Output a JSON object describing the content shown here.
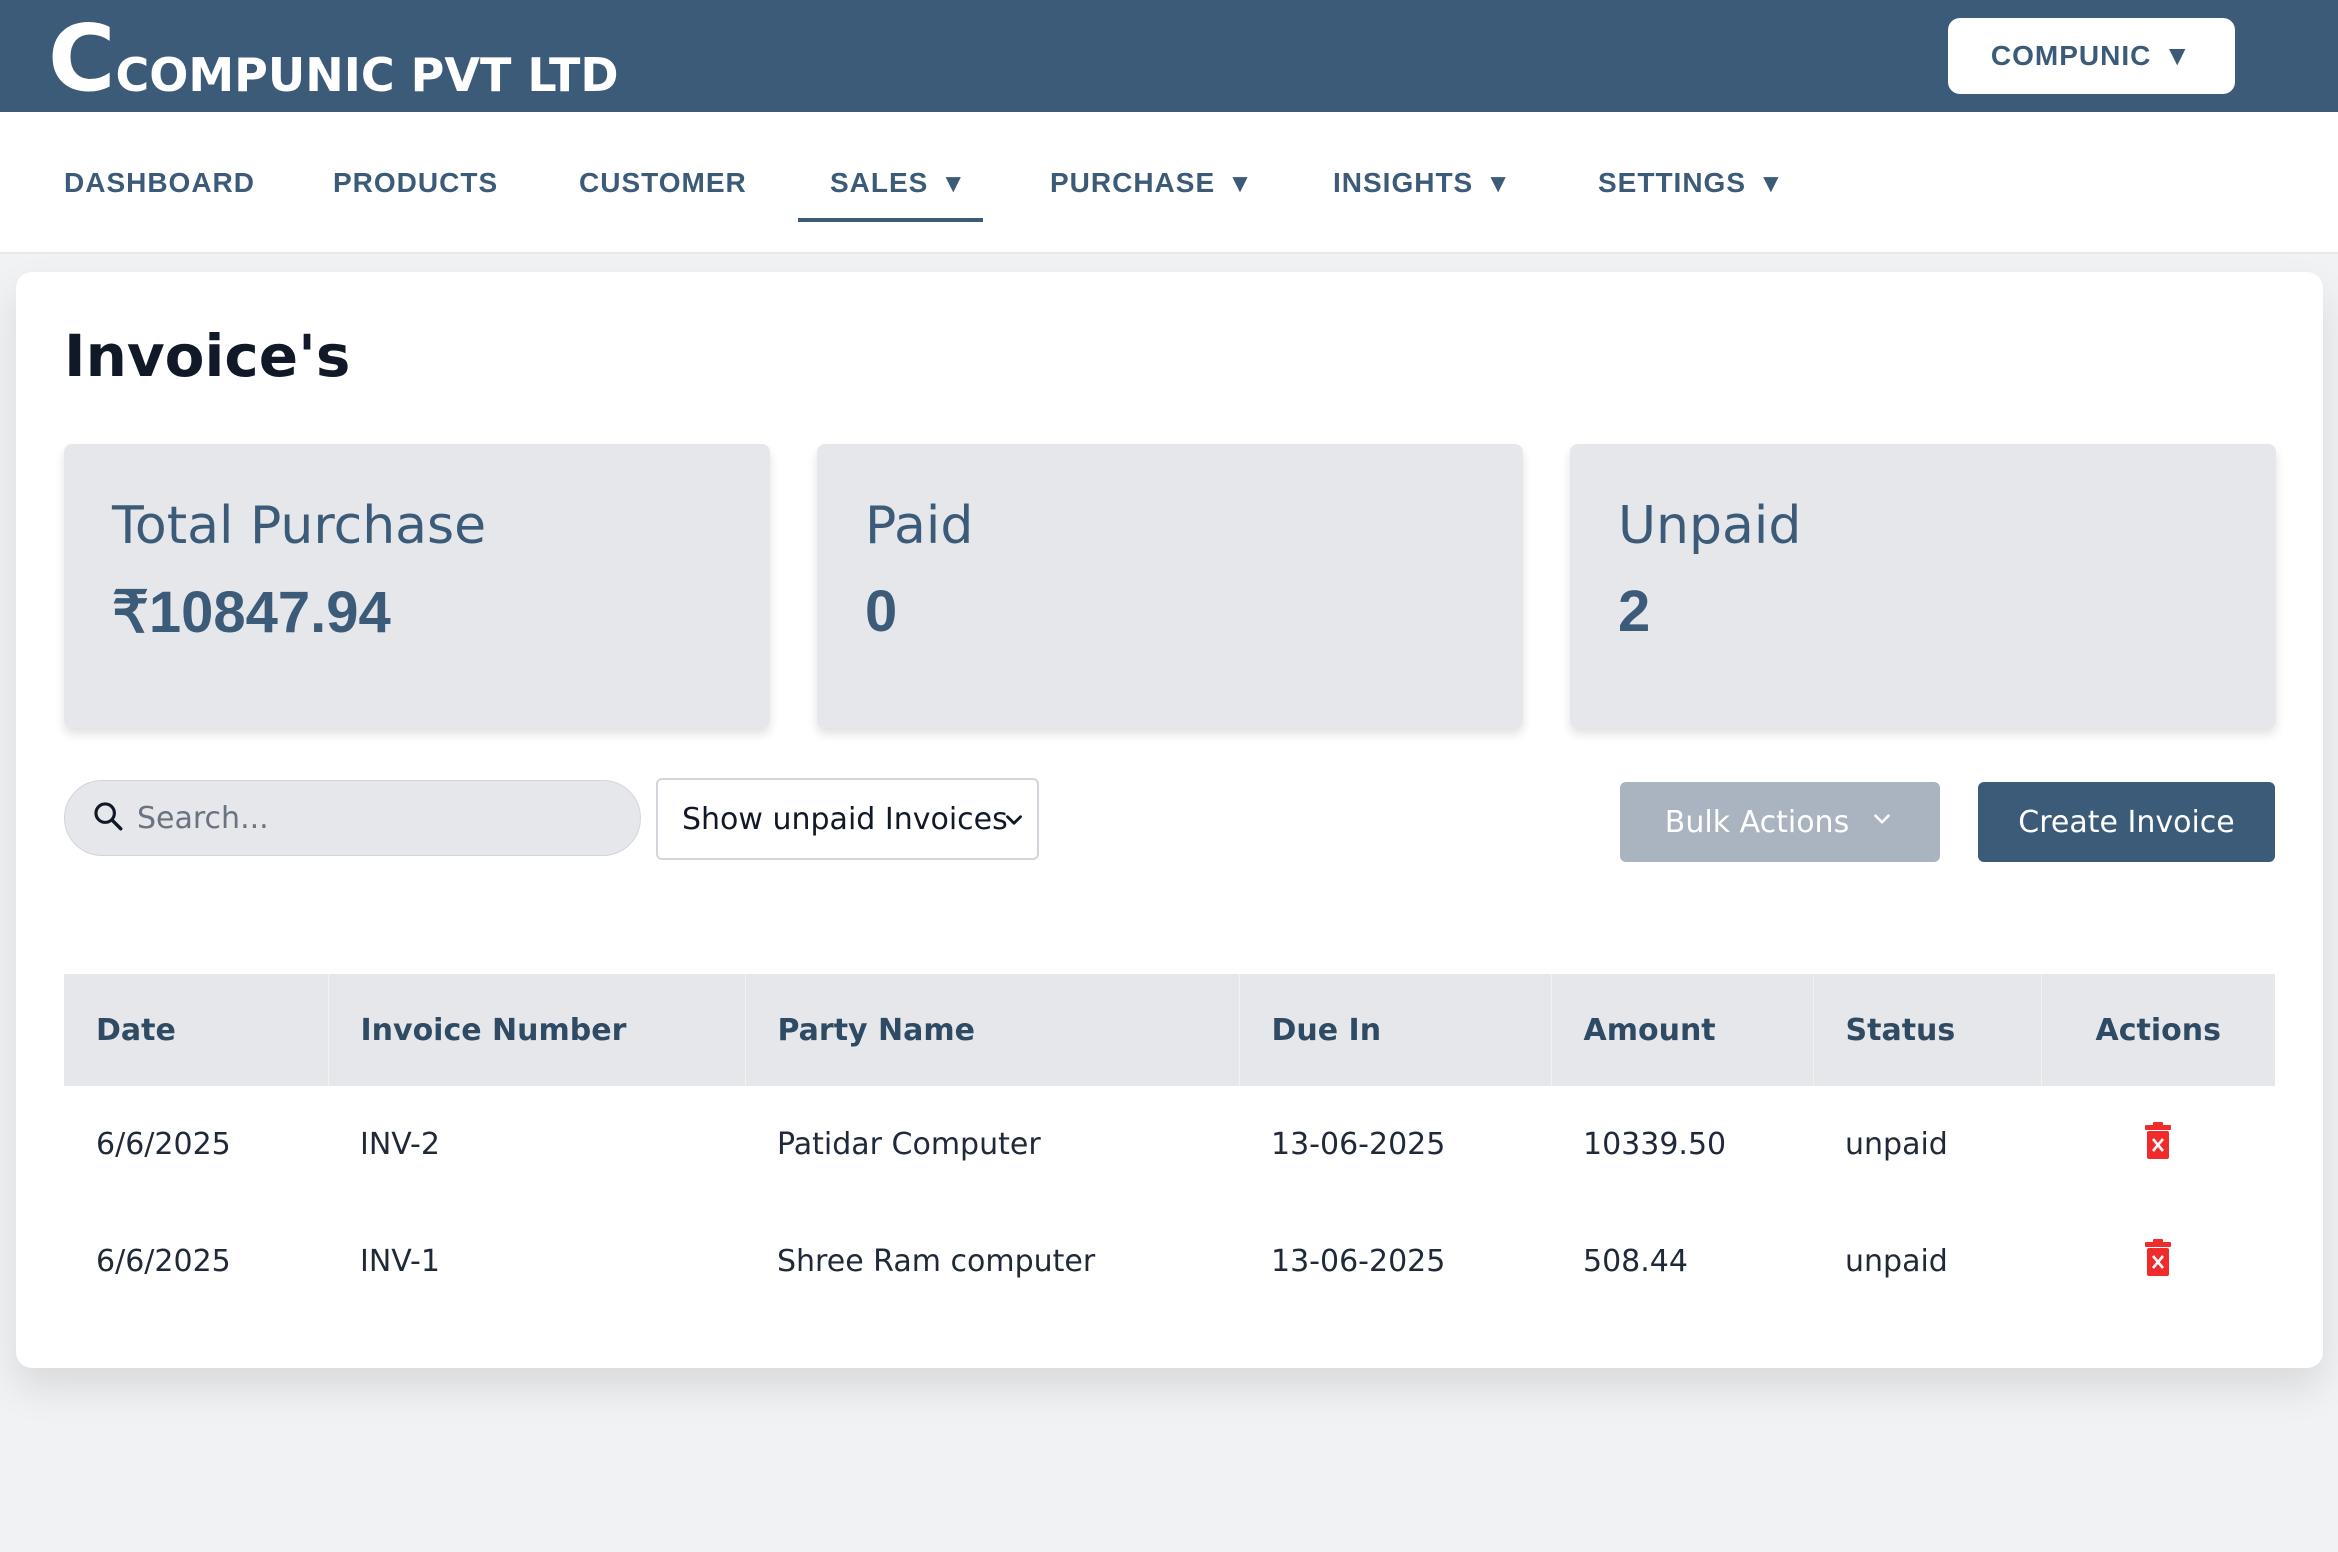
{
  "header": {
    "logo_letter": "C",
    "company_name": "COMPUNIC PVT LTD",
    "account_dropdown": "COMPUNIC"
  },
  "nav": {
    "items": [
      {
        "label": "DASHBOARD",
        "has_dropdown": false
      },
      {
        "label": "PRODUCTS",
        "has_dropdown": false
      },
      {
        "label": "CUSTOMER",
        "has_dropdown": false
      },
      {
        "label": "SALES",
        "has_dropdown": true,
        "active": true
      },
      {
        "label": "PURCHASE",
        "has_dropdown": true
      },
      {
        "label": "INSIGHTS",
        "has_dropdown": true
      },
      {
        "label": "SETTINGS",
        "has_dropdown": true
      }
    ],
    "caret": "▼"
  },
  "page": {
    "title": "Invoice's"
  },
  "stats": [
    {
      "label": "Total Purchase",
      "value": "₹10847.94"
    },
    {
      "label": "Paid",
      "value": "0"
    },
    {
      "label": "Unpaid",
      "value": "2"
    }
  ],
  "toolbar": {
    "search_placeholder": "Search...",
    "filter_selected": "Show unpaid Invoices",
    "bulk_actions_label": "Bulk Actions",
    "create_invoice_label": "Create Invoice"
  },
  "table": {
    "columns": [
      "Date",
      "Invoice Number",
      "Party Name",
      "Due In",
      "Amount",
      "Status",
      "Actions"
    ],
    "rows": [
      {
        "date": "6/6/2025",
        "invoice_number": "INV-2",
        "party_name": "Patidar Computer",
        "due_in": "13-06-2025",
        "amount": "10339.50",
        "status": "unpaid",
        "action_icon": "trash-icon"
      },
      {
        "date": "6/6/2025",
        "invoice_number": "INV-1",
        "party_name": "Shree Ram computer",
        "due_in": "13-06-2025",
        "amount": "508.44",
        "status": "unpaid",
        "action_icon": "trash-icon"
      }
    ]
  },
  "colors": {
    "primary": "#3b5b78",
    "danger": "#ef2b2b",
    "card_bg": "#e5e7eb",
    "disabled_button": "#aab3c0"
  }
}
